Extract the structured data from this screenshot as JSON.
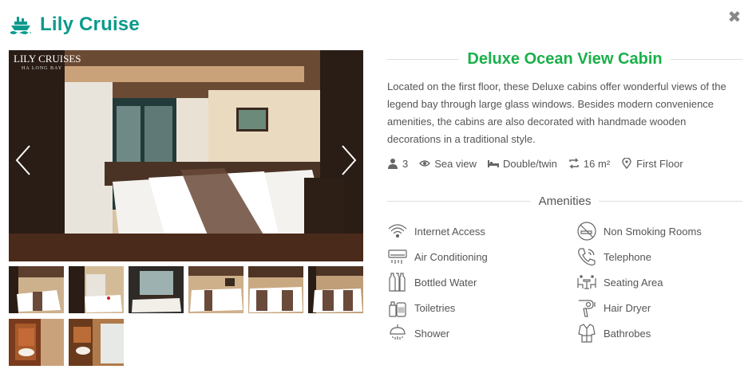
{
  "brand": {
    "name": "Lily Cruise",
    "icon": "ship-icon",
    "color": "#0a9a8c"
  },
  "close": {
    "label": "✖",
    "icon": "close-icon"
  },
  "gallery": {
    "logo_text": "LILY CRUISES",
    "logo_sub": "HA LONG BAY",
    "prev_icon": "chevron-left-icon",
    "next_icon": "chevron-right-icon",
    "thumbnail_count": 8
  },
  "cabin": {
    "title": "Deluxe Ocean View Cabin",
    "title_color": "#1ab04a",
    "description": "Located on the first floor, these Deluxe cabins offer wonderful views of the legend bay through large glass windows. Besides modern convenience amenities, the cabins are also decorated with handmade wooden decorations in a traditional style.",
    "meta": [
      {
        "icon": "guests-icon",
        "text": "3"
      },
      {
        "icon": "eye-icon",
        "text": "Sea view"
      },
      {
        "icon": "bed-icon",
        "text": "Double/twin"
      },
      {
        "icon": "area-icon",
        "text": "16 m²"
      },
      {
        "icon": "map-pin-icon",
        "text": "First Floor"
      }
    ]
  },
  "amenities": {
    "title": "Amenities",
    "left": [
      {
        "icon": "wifi-icon",
        "label": "Internet Access"
      },
      {
        "icon": "air-conditioner-icon",
        "label": "Air Conditioning"
      },
      {
        "icon": "bottles-icon",
        "label": "Bottled Water"
      },
      {
        "icon": "toiletries-icon",
        "label": "Toiletries"
      },
      {
        "icon": "shower-icon",
        "label": "Shower"
      }
    ],
    "right": [
      {
        "icon": "no-smoking-icon",
        "label": "Non Smoking Rooms"
      },
      {
        "icon": "telephone-icon",
        "label": "Telephone"
      },
      {
        "icon": "seating-area-icon",
        "label": "Seating Area"
      },
      {
        "icon": "hair-dryer-icon",
        "label": "Hair Dryer"
      },
      {
        "icon": "bathrobe-icon",
        "label": "Bathrobes"
      }
    ]
  }
}
